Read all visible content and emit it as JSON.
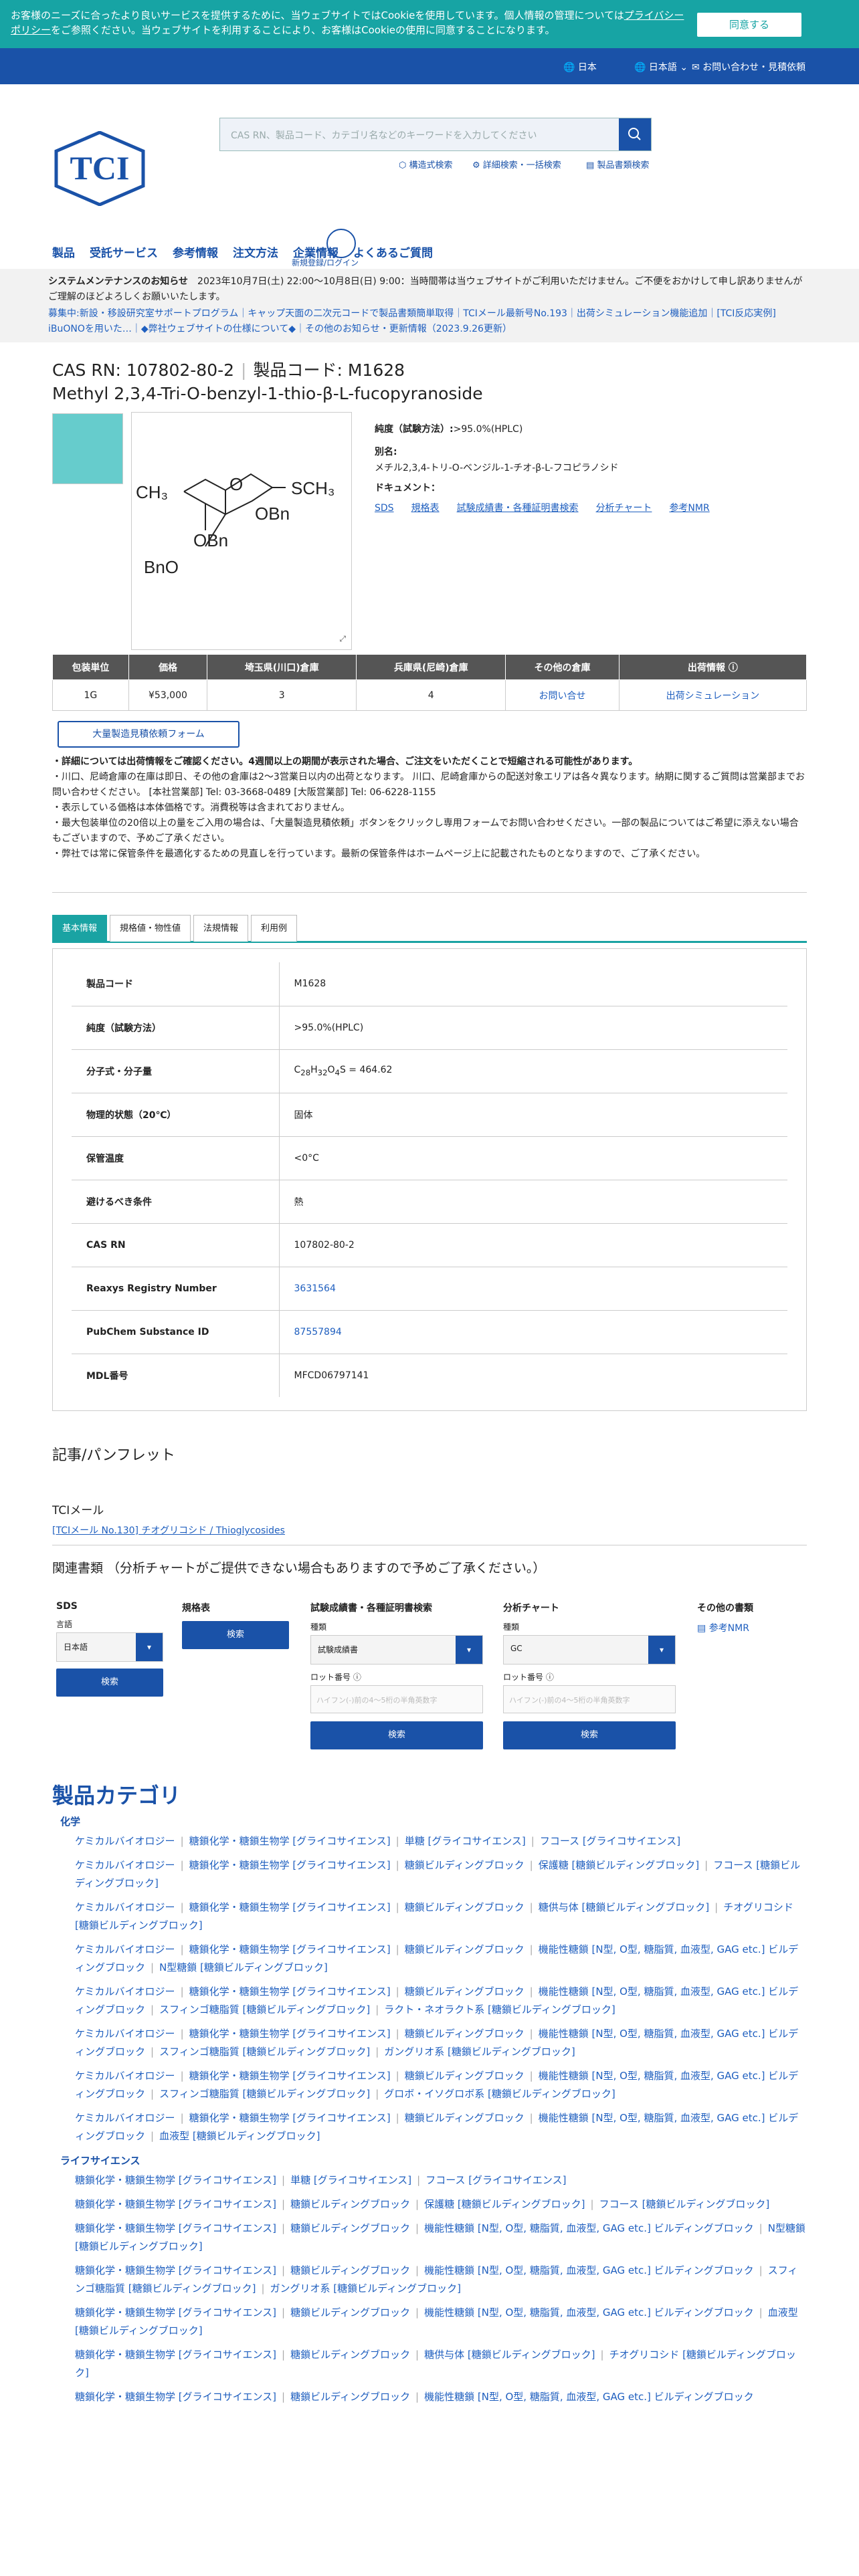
{
  "cookie": {
    "text": "お客様のニーズに合ったより良いサービスを提供するために、当ウェブサイトではCookieを使用しています。個人情報の管理については",
    "link": "プライバシーポリシー",
    "text2": "をご参照ください。当ウェブサイトを利用することにより、お客様はCookieの使用に同意することになります。",
    "button": "同意する"
  },
  "topbar": {
    "country": "日本",
    "language": "日本語",
    "contact": "お問い合わせ・見積依頼"
  },
  "search": {
    "placeholder": "CAS RN、製品コード、カテゴリ名などのキーワードを入力してください",
    "links": [
      "構造式検索",
      "詳細検索・一括検索",
      "製品書類検索"
    ]
  },
  "login": "新規登録/ログイン",
  "nav": [
    "製品",
    "受託サービス",
    "参考情報",
    "注文方法",
    "企業情報",
    "よくあるご質問"
  ],
  "maintenance": {
    "title": "システムメンテナンスのお知らせ",
    "text": "2023年10月7日(土) 22:00〜10月8日(日) 9:00：当時間帯は当ウェブサイトがご利用いただけません。ご不便をおかけして申し訳ありませんがご理解のほどよろしくお願いいたします。",
    "line2": "募集中:新設・移設研究室サポートプログラム｜キャップ天面の二次元コードで製品書類簡単取得｜TCIメール最新号No.193｜出荷シミュレーション機能追加｜[TCI反応実例] iBuONOを用いた…｜◆弊社ウェブサイトの仕様について◆｜その他のお知らせ・更新情報（2023.9.26更新）"
  },
  "product": {
    "cas_label": "CAS RN:",
    "cas": "107802-80-2",
    "code_label": "製品コード:",
    "code": "M1628",
    "name": "Methyl 2,3,4-Tri-O-benzyl-1-thio-β-L-fucopyranoside",
    "purity_label": "純度（試験方法）:",
    "purity": ">95.0%(HPLC)",
    "alias_label": "別名:",
    "alias": "メチル2,3,4-トリ-O-ベンジル-1-チオ-β-L-フコピラノシド",
    "docs_label": "ドキュメント：",
    "docs": [
      "SDS",
      "規格表",
      "試験成績書・各種証明書検索",
      "分析チャート",
      "参考NMR"
    ]
  },
  "stock": {
    "headers": [
      "包装単位",
      "価格",
      "埼玉県(川口)倉庫",
      "兵庫県(尼崎)倉庫",
      "その他の倉庫",
      "出荷情報"
    ],
    "row": [
      "1G",
      "¥53,000",
      "3",
      "4",
      "お問い合せ",
      "出荷シミュレーション"
    ]
  },
  "bulk_button": "大量製造見積依頼フォーム",
  "notes": [
    "・詳細については出荷情報をご確認ください。4週間以上の期間が表示された場合、ご注文をいただくことで短縮される可能性があります。",
    "・川口、尼崎倉庫の在庫は即日、その他の倉庫は2〜3営業日以内の出荷となります。 川口、尼崎倉庫からの配送対象エリアは各々異なります。納期に関するご質問は営業部までお問い合わせください。 [本社営業部] Tel: 03-3668-0489 [大阪営業部] Tel: 06-6228-1155",
    "・表示している価格は本体価格です。消費税等は含まれておりません。",
    "・最大包装単位の20倍以上の量をご入用の場合は、「大量製造見積依頼」ボタンをクリックし専用フォームでお問い合わせください。一部の製品についてはご希望に添えない場合もございますので、予めご了承ください。",
    "・弊社では常に保管条件を最適化するための見直しを行っています。最新の保管条件はホームページ上に記載されたものとなりますので、ご了承ください。"
  ],
  "tabs": [
    "基本情報",
    "規格値・物性値",
    "法規情報",
    "利用例"
  ],
  "spec": [
    [
      "製品コード",
      "M1628"
    ],
    [
      "純度（試験方法）",
      ">95.0%(HPLC)"
    ],
    [
      "分子式・分子量",
      "C28H32O4S = 464.62"
    ],
    [
      "物理的状態（20℃）",
      "固体"
    ],
    [
      "保管温度",
      "<0°C"
    ],
    [
      "避けるべき条件",
      "熱"
    ],
    [
      "CAS RN",
      "107802-80-2"
    ],
    [
      "Reaxys Registry Number",
      "3631564"
    ],
    [
      "PubChem Substance ID",
      "87557894"
    ],
    [
      "MDL番号",
      "MFCD06797141"
    ]
  ],
  "articles": {
    "title": "記事/パンフレット",
    "tci_mail": "TCIメール",
    "link": "[TCIメール No.130] チオグリコシド / Thioglycosides"
  },
  "docsearch": {
    "title": "関連書類 （分析チャートがご提供できない場合もありますので予めご了承ください。）",
    "sds": "SDS",
    "lang_label": "言語",
    "lang": "日本語",
    "spec": "規格表",
    "coa": "試験成績書・各種証明書検索",
    "kind_label": "種類",
    "coa_kind": "試験成績書",
    "chart": "分析チャート",
    "chart_kind": "GC",
    "lot_label": "ロット番号",
    "lot_ph": "ハイフン(-)前の4〜5桁の半角英数字",
    "search": "検索",
    "other": "その他の書類",
    "nmr": "参考NMR"
  },
  "categories": {
    "title": "製品カテゴリ",
    "chem": "化学",
    "life": "ライフサイエンス",
    "chem_blocks": [
      [
        "ケミカルバイオロジー",
        "糖鎖化学・糖鎖生物学 [グライコサイエンス]",
        "単糖 [グライコサイエンス]",
        "フコース [グライコサイエンス]"
      ],
      [
        "ケミカルバイオロジー",
        "糖鎖化学・糖鎖生物学 [グライコサイエンス]",
        "糖鎖ビルディングブロック",
        "保護糖 [糖鎖ビルディングブロック]",
        "フコース [糖鎖ビルディングブロック]"
      ],
      [
        "ケミカルバイオロジー",
        "糖鎖化学・糖鎖生物学 [グライコサイエンス]",
        "糖鎖ビルディングブロック",
        "糖供与体 [糖鎖ビルディングブロック]",
        "チオグリコシド [糖鎖ビルディングブロック]"
      ],
      [
        "ケミカルバイオロジー",
        "糖鎖化学・糖鎖生物学 [グライコサイエンス]",
        "糖鎖ビルディングブロック",
        "機能性糖鎖 [N型, O型, 糖脂質, 血液型, GAG etc.] ビルディングブロック",
        "N型糖鎖 [糖鎖ビルディングブロック]"
      ],
      [
        "ケミカルバイオロジー",
        "糖鎖化学・糖鎖生物学 [グライコサイエンス]",
        "糖鎖ビルディングブロック",
        "機能性糖鎖 [N型, O型, 糖脂質, 血液型, GAG etc.] ビルディングブロック",
        "スフィンゴ糖脂質 [糖鎖ビルディングブロック]",
        "ラクト・ネオラクト系 [糖鎖ビルディングブロック]"
      ],
      [
        "ケミカルバイオロジー",
        "糖鎖化学・糖鎖生物学 [グライコサイエンス]",
        "糖鎖ビルディングブロック",
        "機能性糖鎖 [N型, O型, 糖脂質, 血液型, GAG etc.] ビルディングブロック",
        "スフィンゴ糖脂質 [糖鎖ビルディングブロック]",
        "ガングリオ系 [糖鎖ビルディングブロック]"
      ],
      [
        "ケミカルバイオロジー",
        "糖鎖化学・糖鎖生物学 [グライコサイエンス]",
        "糖鎖ビルディングブロック",
        "機能性糖鎖 [N型, O型, 糖脂質, 血液型, GAG etc.] ビルディングブロック",
        "スフィンゴ糖脂質 [糖鎖ビルディングブロック]",
        "グロボ・イソグロボ系 [糖鎖ビルディングブロック]"
      ],
      [
        "ケミカルバイオロジー",
        "糖鎖化学・糖鎖生物学 [グライコサイエンス]",
        "糖鎖ビルディングブロック",
        "機能性糖鎖 [N型, O型, 糖脂質, 血液型, GAG etc.] ビルディングブロック",
        "血液型 [糖鎖ビルディングブロック]"
      ]
    ],
    "life_blocks": [
      [
        "糖鎖化学・糖鎖生物学 [グライコサイエンス]",
        "単糖 [グライコサイエンス]",
        "フコース [グライコサイエンス]"
      ],
      [
        "糖鎖化学・糖鎖生物学 [グライコサイエンス]",
        "糖鎖ビルディングブロック",
        "保護糖 [糖鎖ビルディングブロック]",
        "フコース [糖鎖ビルディングブロック]"
      ],
      [
        "糖鎖化学・糖鎖生物学 [グライコサイエンス]",
        "糖鎖ビルディングブロック",
        "機能性糖鎖 [N型, O型, 糖脂質, 血液型, GAG etc.] ビルディングブロック",
        "N型糖鎖 [糖鎖ビルディングブロック]"
      ],
      [
        "糖鎖化学・糖鎖生物学 [グライコサイエンス]",
        "糖鎖ビルディングブロック",
        "機能性糖鎖 [N型, O型, 糖脂質, 血液型, GAG etc.] ビルディングブロック",
        "スフィンゴ糖脂質 [糖鎖ビルディングブロック]",
        "ガングリオ系 [糖鎖ビルディングブロック]"
      ],
      [
        "糖鎖化学・糖鎖生物学 [グライコサイエンス]",
        "糖鎖ビルディングブロック",
        "機能性糖鎖 [N型, O型, 糖脂質, 血液型, GAG etc.] ビルディングブロック",
        "血液型 [糖鎖ビルディングブロック]"
      ],
      [
        "糖鎖化学・糖鎖生物学 [グライコサイエンス]",
        "糖鎖ビルディングブロック",
        "糖供与体 [糖鎖ビルディングブロック]",
        "チオグリコシド [糖鎖ビルディングブロック]"
      ],
      [
        "糖鎖化学・糖鎖生物学 [グライコサイエンス]",
        "糖鎖ビルディングブロック",
        "機能性糖鎖 [N型, O型, 糖脂質, 血液型, GAG etc.] ビルディングブロック"
      ]
    ]
  },
  "colors": {
    "brand": "#1a52a8",
    "teal": "#1aa3a3"
  }
}
